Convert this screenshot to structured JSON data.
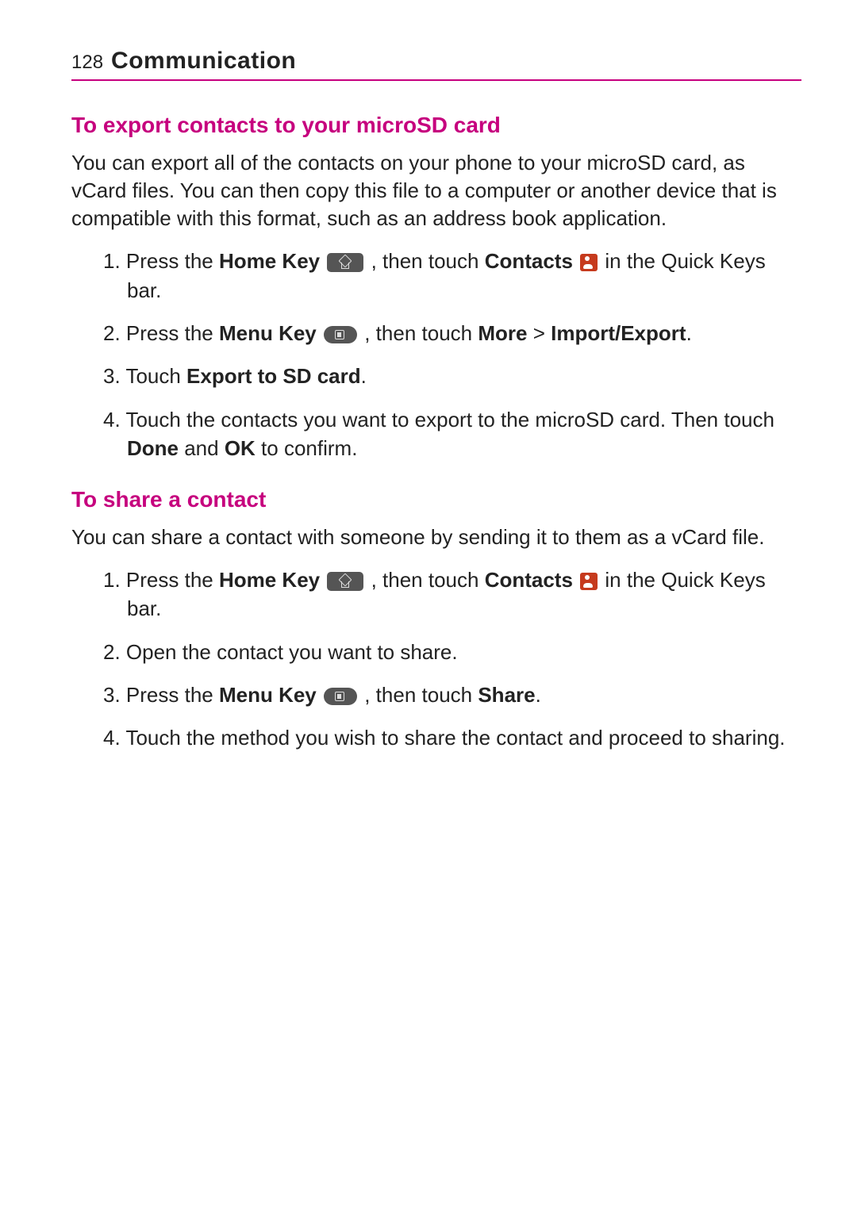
{
  "header": {
    "page_number": "128",
    "chapter_title": "Communication"
  },
  "section1": {
    "heading": "To export contacts to your microSD card",
    "intro": "You can export all of the contacts on your phone to your microSD card, as vCard files. You can then copy this file to a computer or another device that is compatible with this format, such as an address book application.",
    "steps": {
      "s1": {
        "num": "1.",
        "t1": " Press the ",
        "b1": "Home Key",
        "t2": " , then touch ",
        "b2": "Contacts",
        "t3": " in the Quick Keys bar."
      },
      "s2": {
        "num": "2.",
        "t1": " Press the ",
        "b1": "Menu Key",
        "t2": " , then touch ",
        "b2": "More",
        "t3": " > ",
        "b3": "Import/Export",
        "t4": "."
      },
      "s3": {
        "num": "3.",
        "t1": " Touch ",
        "b1": "Export to SD card",
        "t2": "."
      },
      "s4": {
        "num": "4.",
        "t1": " Touch the contacts you want to export to the microSD card. Then touch ",
        "b1": "Done",
        "t2": " and ",
        "b2": "OK",
        "t3": " to confirm."
      }
    }
  },
  "section2": {
    "heading": "To share a contact",
    "intro": "You can share a contact with someone by sending it to them as a vCard file.",
    "steps": {
      "s1": {
        "num": "1.",
        "t1": " Press the ",
        "b1": "Home Key",
        "t2": " , then touch ",
        "b2": "Contacts",
        "t3": " in the Quick Keys bar."
      },
      "s2": {
        "num": "2.",
        "t1": " Open the contact you want to share."
      },
      "s3": {
        "num": "3.",
        "t1": " Press the ",
        "b1": "Menu Key",
        "t2": " , then touch ",
        "b2": "Share",
        "t3": "."
      },
      "s4": {
        "num": "4.",
        "t1": " Touch the method you wish to share the contact and proceed to sharing."
      }
    }
  }
}
